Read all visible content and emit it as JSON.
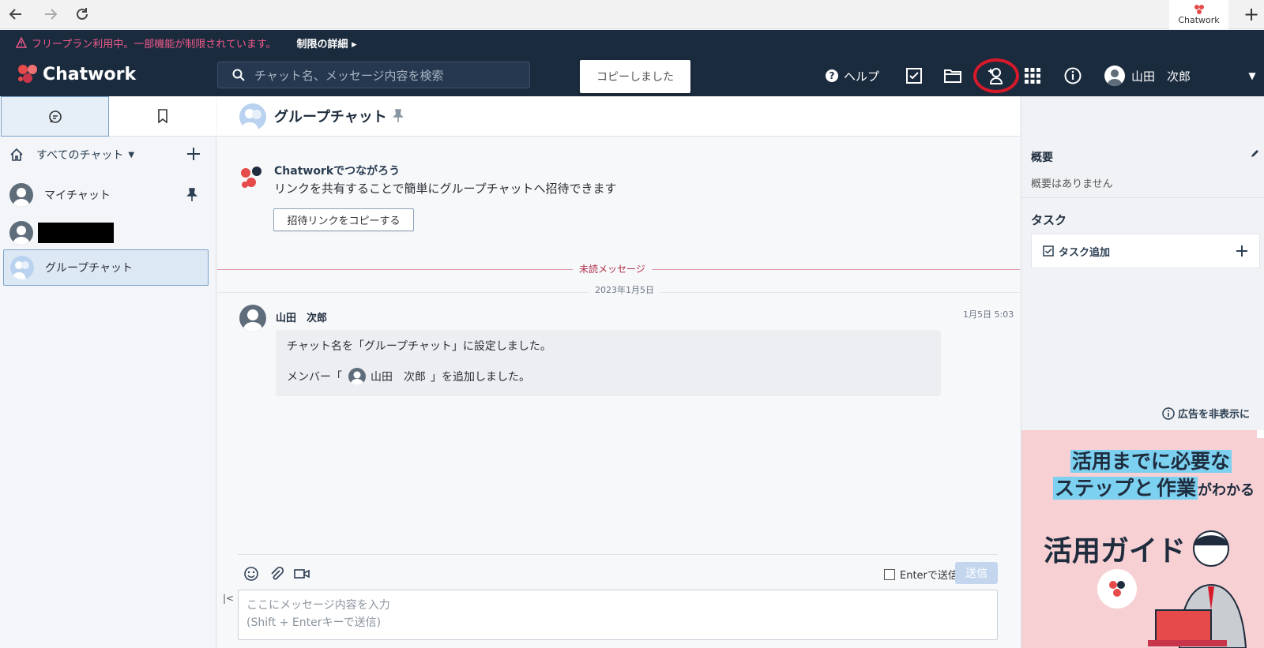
{
  "browser": {
    "tab_title": "Chatwork",
    "new_tab": "+"
  },
  "banner": {
    "text": "フリープラン利用中。一部機能が制限されています。",
    "link": "制限の詳細"
  },
  "header": {
    "logo": "Chatwork",
    "search_placeholder": "チャット名、メッセージ内容を検索",
    "toast": "コピーしました",
    "help": "ヘルプ",
    "user_name": "山田　次郎"
  },
  "sidebar": {
    "filter": "すべてのチャット",
    "items": [
      {
        "label": "マイチャット"
      },
      {
        "label": ""
      },
      {
        "label": "グループチャット"
      }
    ]
  },
  "chat": {
    "title": "グループチャット",
    "invite": "招待",
    "promo_title": "Chatworkでつながろう",
    "promo_text": "リンクを共有することで簡単にグループチャットへ招待できます",
    "copy_link": "招待リンクをコピーする",
    "unread_label": "未読メッセージ",
    "date": "2023年1月5日",
    "message": {
      "sender": "山田　次郎",
      "time": "1月5日 5:03",
      "line1": "チャット名を「グループチャット」に設定しました。",
      "line2_prefix": "メンバー「",
      "line2_name": "山田　次郎",
      "line2_suffix": "」を追加しました。"
    }
  },
  "composer": {
    "enter_to_send": "Enterで送信",
    "send": "送信",
    "placeholder_line1": "ここにメッセージ内容を入力",
    "placeholder_line2": "(Shift + Enterキーで送信)"
  },
  "right_panel": {
    "summary_title": "概要",
    "summary_text": "概要はありません",
    "task_title": "タスク",
    "task_add": "タスク追加",
    "hide_ads": "広告を非表示に"
  },
  "ad": {
    "line1_hl": "活用までに必要な",
    "line2_hl_a": "ステップと",
    "line2_hl_b": "作業",
    "line2_rest": "がわかる",
    "title": "活用ガイド"
  },
  "colors": {
    "header_bg": "#1b2b3e",
    "banner_warning": "#f05a8a",
    "brand_red": "#e64a4a",
    "highlight_circle": "#d7192a",
    "ad_bg": "#f7d0d4"
  }
}
